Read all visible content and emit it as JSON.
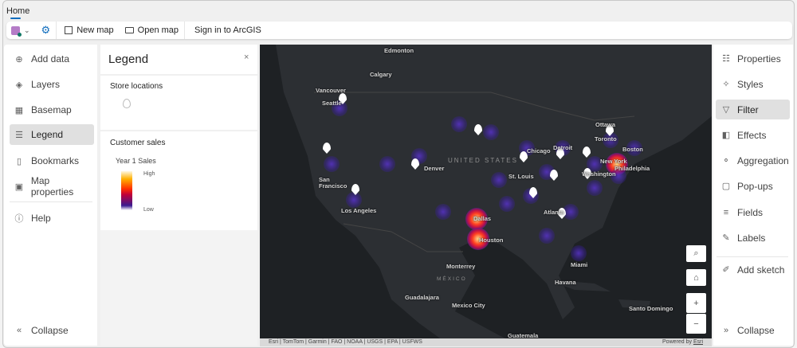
{
  "tabs": [
    {
      "label": "Home"
    }
  ],
  "toolbar": {
    "new_map": "New map",
    "open_map": "Open map",
    "sign_in": "Sign in to ArcGIS"
  },
  "left_nav": {
    "items": [
      {
        "label": "Add data",
        "icon": "plus-circle-icon"
      },
      {
        "label": "Layers",
        "icon": "layers-icon"
      },
      {
        "label": "Basemap",
        "icon": "basemap-grid-icon"
      },
      {
        "label": "Legend",
        "icon": "legend-list-icon",
        "selected": true
      },
      {
        "label": "Bookmarks",
        "icon": "bookmark-icon"
      },
      {
        "label": "Map properties",
        "icon": "map-icon"
      },
      {
        "label": "Help",
        "icon": "help-icon"
      }
    ],
    "collapse": "Collapse"
  },
  "legend": {
    "title": "Legend",
    "close": "×",
    "layers": [
      {
        "title": "Store locations"
      },
      {
        "title": "Customer sales",
        "field": "Year 1 Sales",
        "high": "High",
        "low": "Low"
      }
    ]
  },
  "map": {
    "country_labels": [
      "UNITED STATES",
      "MÉXICO"
    ],
    "cities": [
      "Edmonton",
      "Calgary",
      "Vancouver",
      "Seattle",
      "San Francisco",
      "Los Angeles",
      "Denver",
      "St. Louis",
      "Chicago",
      "Detroit",
      "Toronto",
      "Ottawa",
      "Boston",
      "New York",
      "Philadelphia",
      "Washington",
      "Atlanta",
      "Dallas",
      "Houston",
      "Monterrey",
      "Miami",
      "Havana",
      "Guadalajara",
      "Mexico City",
      "Santo Domingo",
      "Guatemala"
    ],
    "attribution": "Esri | TomTom | Garmin | FAO | NOAA | USGS | EPA | USFWS",
    "powered_by": "Powered by",
    "powered_link": "Esri",
    "controls": {
      "zoom_in": "+",
      "zoom_out": "−"
    }
  },
  "right_nav": {
    "items": [
      {
        "label": "Properties"
      },
      {
        "label": "Styles"
      },
      {
        "label": "Filter",
        "selected": true
      },
      {
        "label": "Effects"
      },
      {
        "label": "Aggregation"
      },
      {
        "label": "Pop-ups"
      },
      {
        "label": "Fields"
      },
      {
        "label": "Labels"
      },
      {
        "label": "Add sketch"
      }
    ],
    "collapse": "Collapse"
  },
  "colors": {
    "accent": "#0f6cbd",
    "map_bg": "#1e2124",
    "heat_high": "#ffd27a",
    "heat_low": "#3a2aa0"
  }
}
